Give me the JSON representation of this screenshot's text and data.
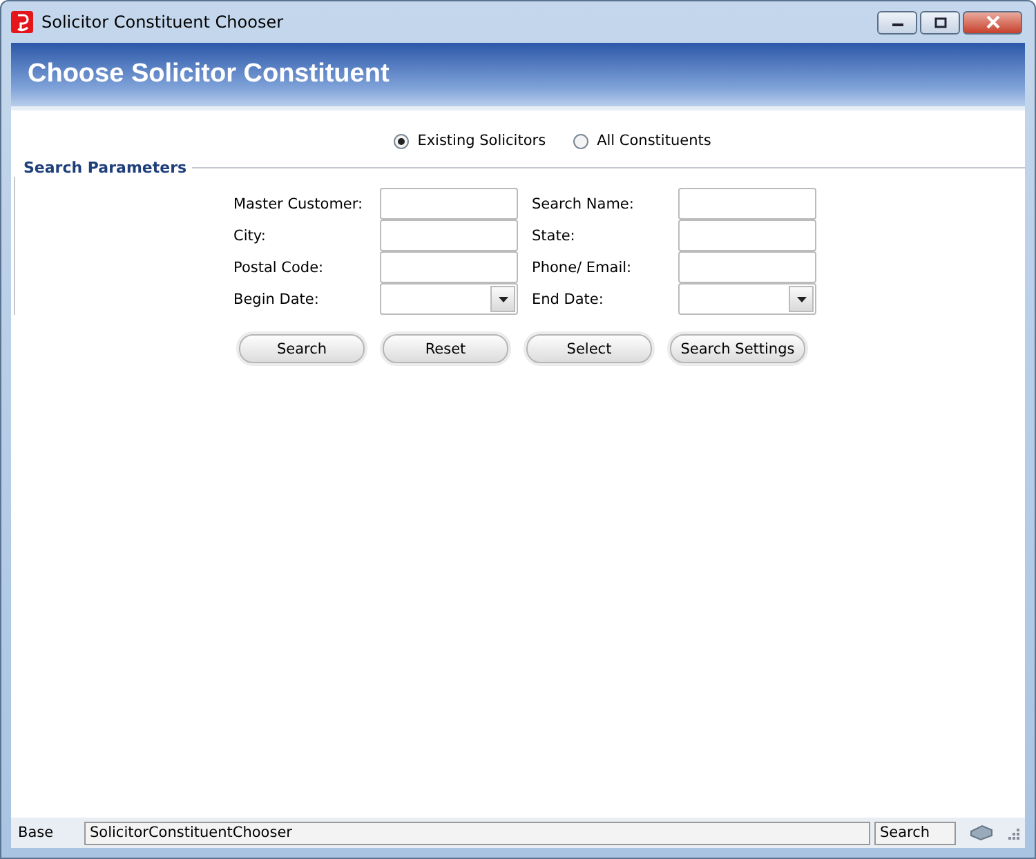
{
  "window": {
    "title": "Solicitor Constituent Chooser"
  },
  "header": {
    "title": "Choose Solicitor Constituent"
  },
  "mode_options": [
    {
      "label": "Existing Solicitors",
      "selected": true
    },
    {
      "label": "All Constituents",
      "selected": false
    }
  ],
  "search_parameters": {
    "title": "Search Parameters",
    "fields": [
      {
        "label": "Master Customer:",
        "kind": "text"
      },
      {
        "label": "Search Name:",
        "kind": "text"
      },
      {
        "label": "City:",
        "kind": "text"
      },
      {
        "label": "State:",
        "kind": "text"
      },
      {
        "label": "Postal Code:",
        "kind": "text"
      },
      {
        "label": "Phone/ Email:",
        "kind": "text"
      },
      {
        "label": "Begin Date:",
        "kind": "date"
      },
      {
        "label": "End Date:",
        "kind": "date"
      }
    ],
    "buttons": [
      "Search",
      "Reset",
      "Select",
      "Search Settings"
    ]
  },
  "status_bar": {
    "left": "Base",
    "center": "SolicitorConstituentChooser",
    "right": "Search"
  }
}
